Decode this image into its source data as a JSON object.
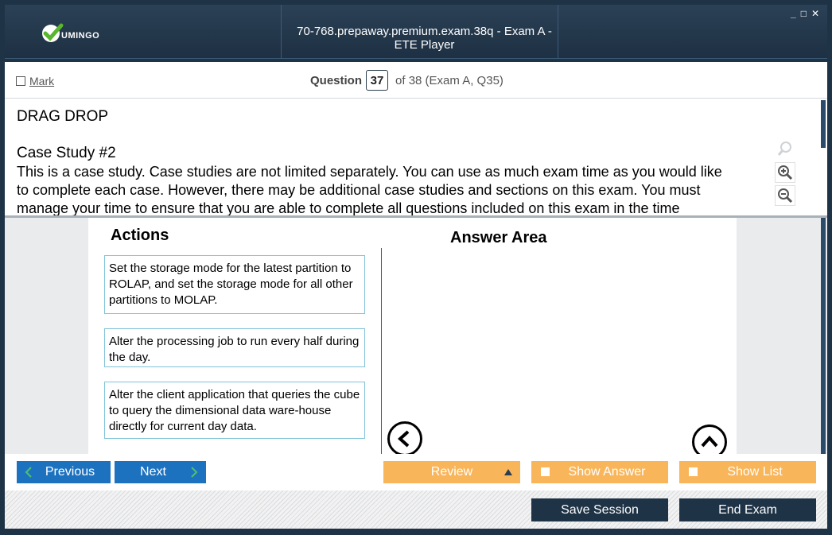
{
  "window": {
    "title": "70-768.prepaway.premium.exam.38q - Exam A - ETE Player",
    "logo_text": "UMINGO",
    "controls": [
      "_",
      "□",
      "✕"
    ]
  },
  "question_bar": {
    "mark_label": "Mark",
    "question_label": "Question",
    "question_number": "37",
    "of_text": "of 38 (Exam A, Q35)"
  },
  "question": {
    "type": "DRAG DROP",
    "case_title": "Case Study #2",
    "body_lines": [
      "This is a case study. Case studies are not limited separately. You can use as much exam time as you would like",
      "to complete each case. However, there may be additional case studies and sections on this exam. You must",
      "manage your time to ensure that you are able to complete all questions included on this exam in the time"
    ]
  },
  "workarea": {
    "actions_title": "Actions",
    "answer_title": "Answer Area",
    "actions": [
      "Set the storage mode for the latest partition to ROLAP, and set the storage mode for all other partitions to MOLAP.",
      "Alter the processing job to run every half during the day.",
      "Alter the client application that queries the cube to query the dimensional data ware-house directly for current day data."
    ]
  },
  "nav": {
    "previous": "Previous",
    "next": "Next",
    "review": "Review",
    "show_answer": "Show Answer",
    "show_list": "Show List"
  },
  "footer": {
    "save_session": "Save Session",
    "end_exam": "End Exam"
  },
  "colors": {
    "title_bar": "#1f3346",
    "nav_blue": "#1d72c0",
    "nav_orange": "#f9b55a",
    "action_border": "#7fc3d8"
  }
}
